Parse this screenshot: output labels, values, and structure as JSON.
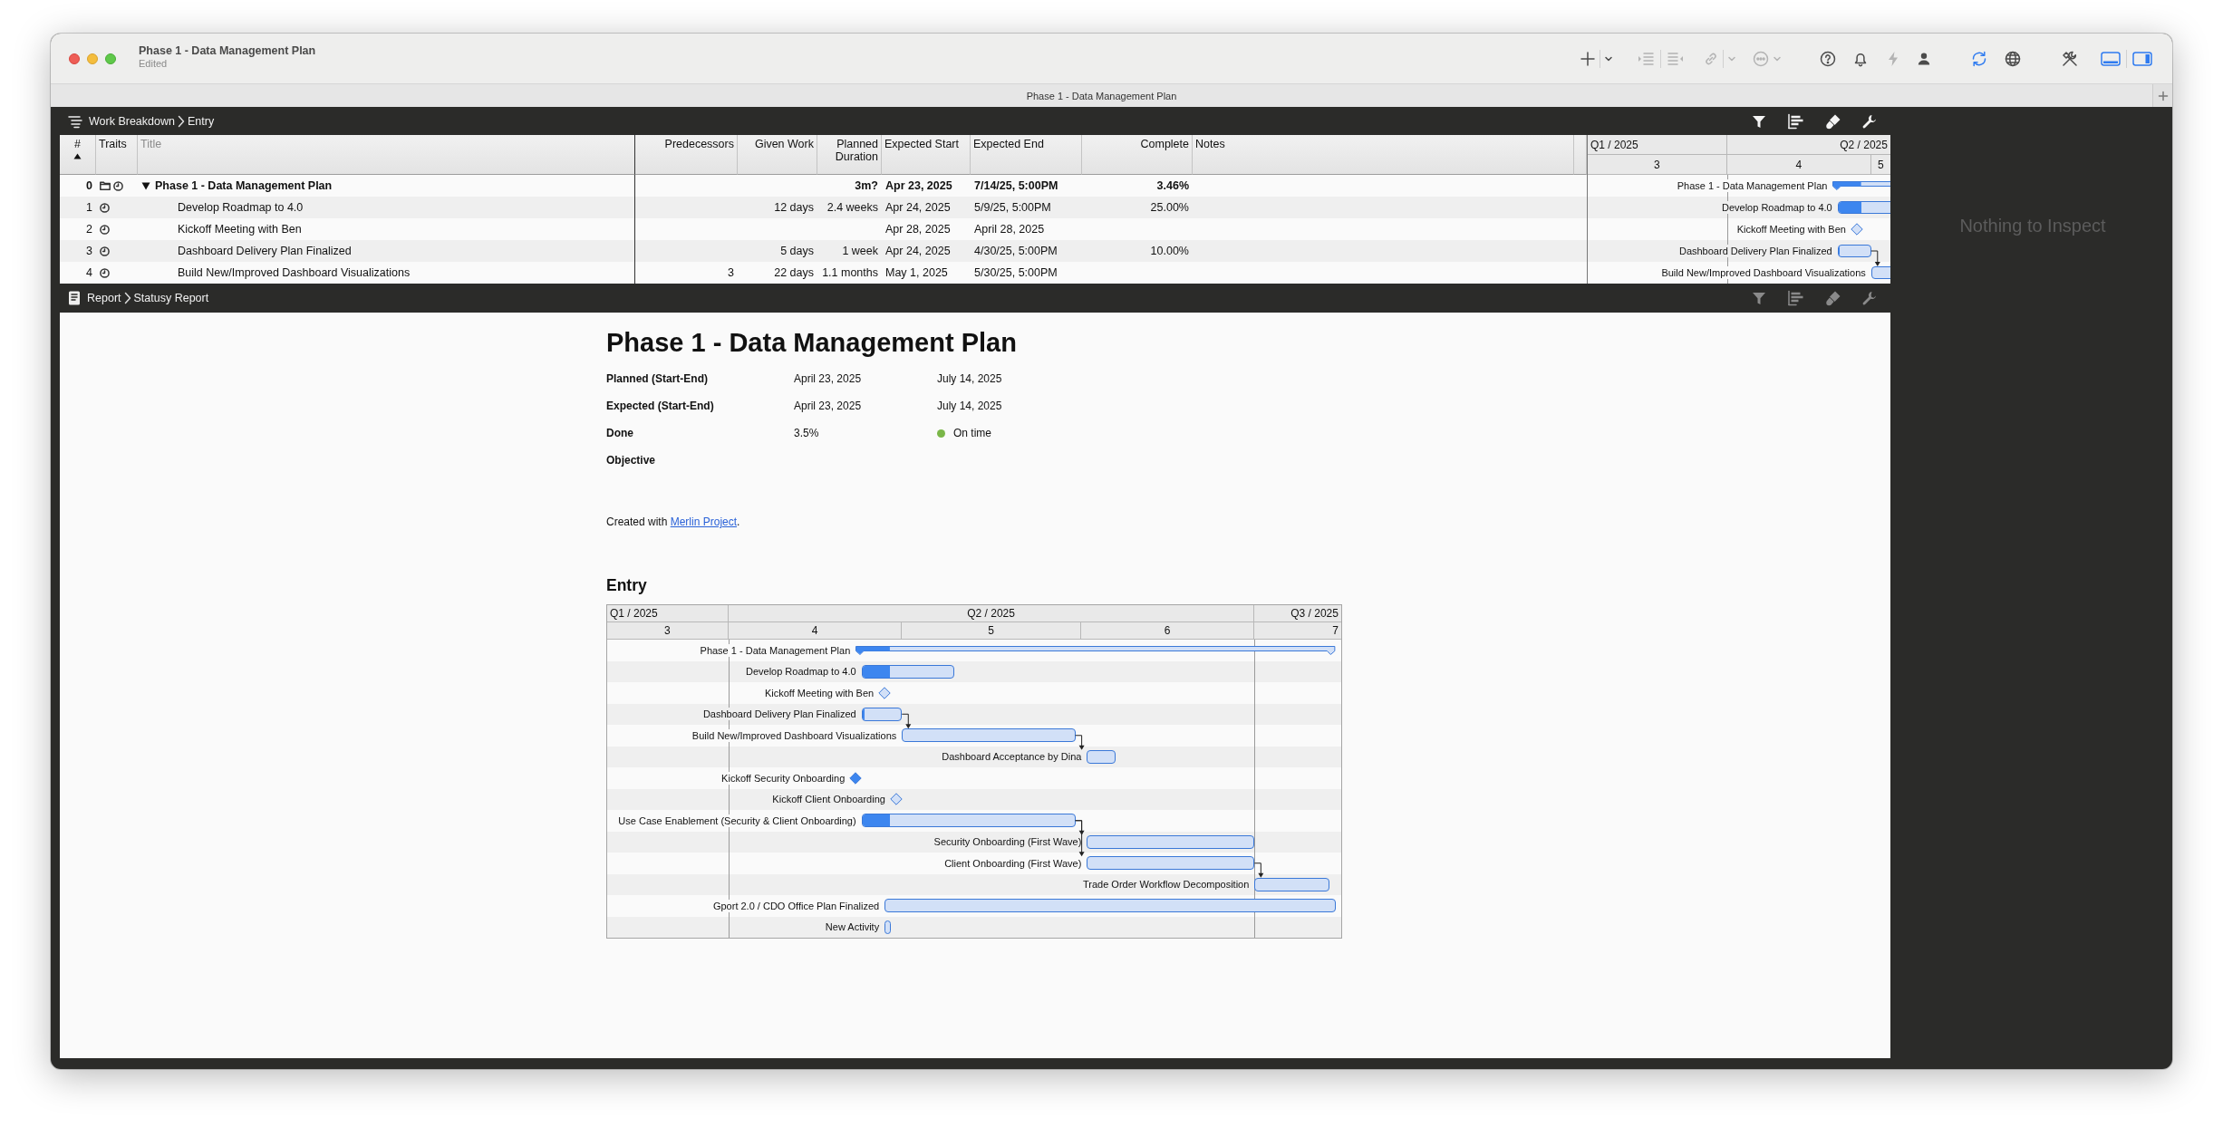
{
  "window": {
    "title": "Phase 1 - Data Management Plan",
    "subtitle": "Edited",
    "tab": "Phase 1 - Data Management Plan"
  },
  "toolbar": [
    {
      "kind": "add",
      "disabled": false,
      "on": false
    },
    {
      "kind": "menu",
      "disabled": false,
      "on": false
    },
    {
      "kind": "indent",
      "disabled": true,
      "on": false
    },
    {
      "kind": "outdent",
      "disabled": true,
      "on": false
    },
    {
      "kind": "link",
      "disabled": true,
      "on": false
    },
    {
      "kind": "menu",
      "disabled": true,
      "on": false
    },
    {
      "kind": "more",
      "disabled": true,
      "on": false
    },
    {
      "kind": "help",
      "disabled": false,
      "on": false
    },
    {
      "kind": "bell",
      "disabled": false,
      "on": false
    },
    {
      "kind": "bolt",
      "disabled": true,
      "on": false
    },
    {
      "kind": "person",
      "disabled": false,
      "on": false
    },
    {
      "kind": "sync",
      "disabled": false,
      "on": true
    },
    {
      "kind": "globe",
      "disabled": false,
      "on": false
    },
    {
      "kind": "tools",
      "disabled": false,
      "on": false
    },
    {
      "kind": "bottompanel",
      "disabled": false,
      "on": true
    },
    {
      "kind": "sidepanel",
      "disabled": false,
      "on": true
    }
  ],
  "outline": {
    "kind": "outline",
    "path": [
      "Work Breakdown",
      "Entry"
    ],
    "tools": [
      {
        "kind": "filter",
        "disabled": false
      },
      {
        "kind": "bars",
        "disabled": false
      },
      {
        "kind": "brush",
        "disabled": false
      },
      {
        "kind": "wrench",
        "disabled": false
      }
    ],
    "columns": [
      {
        "label": "#",
        "sorted": true
      },
      {
        "label": "Traits"
      },
      {
        "label": "Title"
      },
      {
        "label": "Predecessors"
      },
      {
        "label": "Given Work"
      },
      {
        "label": "Planned Duration"
      },
      {
        "label": "Expected Start"
      },
      {
        "label": "Expected End"
      },
      {
        "label": "Complete"
      },
      {
        "label": "Notes"
      }
    ],
    "timeline": {
      "quarters": [
        {
          "label": "Q1 / 2025"
        },
        {
          "label": "Q2 / 2025"
        }
      ],
      "months": [
        {
          "label": "3"
        },
        {
          "label": "4"
        },
        {
          "label": "5"
        }
      ]
    },
    "rows": [
      {
        "number": "0",
        "expanded": true,
        "title": "Phase 1 - Data Management Plan",
        "planned_duration": "3m?",
        "expected_start": "Apr 23, 2025",
        "expected_end": "7/14/25, 5:00PM",
        "complete": "3.46%",
        "bar": {
          "label": "Phase 1 - Data Management Plan",
          "kind": "summary",
          "level": 0.07
        },
        "children": [
          {
            "number": "1",
            "title": "Develop Roadmap to 4.0",
            "given_work": "12 days",
            "planned_duration": "2.4 weeks",
            "expected_start": "Apr 24, 2025",
            "expected_end": "5/9/25, 5:00PM",
            "complete": "25.00%",
            "bar": {
              "label": "Develop Roadmap to 4.0",
              "kind": "task",
              "level": 0.3
            }
          },
          {
            "number": "2",
            "title": "Kickoff Meeting with Ben",
            "expected_start": "Apr 28, 2025",
            "expected_end": "April 28, 2025",
            "bar": {
              "label": "Kickoff Meeting with Ben",
              "kind": "milestone",
              "filled": false
            }
          },
          {
            "number": "3",
            "title": "Dashboard Delivery Plan Finalized",
            "given_work": "5 days",
            "planned_duration": "1 week",
            "expected_start": "Apr 24, 2025",
            "expected_end": "4/30/25, 5:00PM",
            "complete": "10.00%",
            "bar": {
              "label": "Dashboard Delivery Plan Finalized",
              "kind": "task",
              "level": 0.05
            }
          },
          {
            "number": "4",
            "title": "Build New/Improved Dashboard Visualizations",
            "predecessors": "3",
            "given_work": "22 days",
            "planned_duration": "1.1 months",
            "expected_start": "May 1, 2025",
            "expected_end": "5/30/25, 5:00PM",
            "bar": {
              "label": "Build New/Improved Dashboard Visualizations",
              "kind": "task",
              "linked": true
            }
          }
        ]
      }
    ]
  },
  "report_pane": {
    "kind": "report",
    "path": [
      "Report",
      "Statusy Report"
    ],
    "tools": [
      {
        "kind": "filter",
        "disabled": true
      },
      {
        "kind": "bars",
        "disabled": true
      },
      {
        "kind": "brush",
        "disabled": true
      },
      {
        "kind": "wrench",
        "disabled": true
      }
    ],
    "title": "Phase 1 - Data Management Plan",
    "fields": [
      {
        "label": "Planned (Start-End)",
        "values": [
          "April 23, 2025",
          "July 14, 2025"
        ]
      },
      {
        "label": "Expected (Start-End)",
        "values": [
          "April 23, 2025",
          "July 14, 2025"
        ]
      },
      {
        "label": "Done",
        "values": [
          "3.5%"
        ],
        "status": {
          "label": "On time",
          "color": "#7ab648"
        }
      },
      {
        "label": "Objective"
      }
    ],
    "credit": {
      "before": "Created with ",
      "link": "Merlin Project",
      "after": "."
    },
    "section": "Entry",
    "chart": {
      "timeline": {
        "quarters": [
          {
            "label": "Q1 / 2025"
          },
          {
            "label": "Q2 / 2025"
          },
          {
            "label": "Q3 / 2025"
          }
        ],
        "months": [
          {
            "label": "3"
          },
          {
            "label": "4"
          },
          {
            "label": "5"
          },
          {
            "label": "6"
          },
          {
            "label": "7"
          }
        ]
      },
      "tasks": [
        {
          "label": "Phase 1 - Data Management Plan",
          "kind": "summary",
          "level": 0.07
        },
        {
          "label": "Develop Roadmap to 4.0",
          "kind": "task",
          "level": 0.3
        },
        {
          "label": "Kickoff Meeting with Ben",
          "kind": "milestone",
          "filled": false
        },
        {
          "label": "Dashboard Delivery Plan Finalized",
          "kind": "task",
          "level": 0.06
        },
        {
          "label": "Build New/Improved Dashboard Visualizations",
          "kind": "task",
          "linked": true
        },
        {
          "label": "Dashboard Acceptance by Dina",
          "kind": "task",
          "linked": true
        },
        {
          "label": "Kickoff Security Onboarding",
          "kind": "milestone",
          "filled": true
        },
        {
          "label": "Kickoff Client Onboarding",
          "kind": "milestone",
          "filled": false
        },
        {
          "label": "Use Case Enablement (Security & Client Onboarding)",
          "kind": "task",
          "level": 0.13
        },
        {
          "label": "Security Onboarding (First Wave)",
          "kind": "task",
          "linked": true
        },
        {
          "label": "Client Onboarding (First Wave)",
          "kind": "task",
          "linked": true
        },
        {
          "label": "Trade Order Workflow Decomposition",
          "kind": "task",
          "linked": true
        },
        {
          "label": "Gport 2.0 / CDO Office Plan Finalized",
          "kind": "task"
        },
        {
          "label": "New Activity",
          "kind": "task"
        }
      ]
    }
  },
  "inspector": {
    "message": "Nothing to Inspect"
  }
}
